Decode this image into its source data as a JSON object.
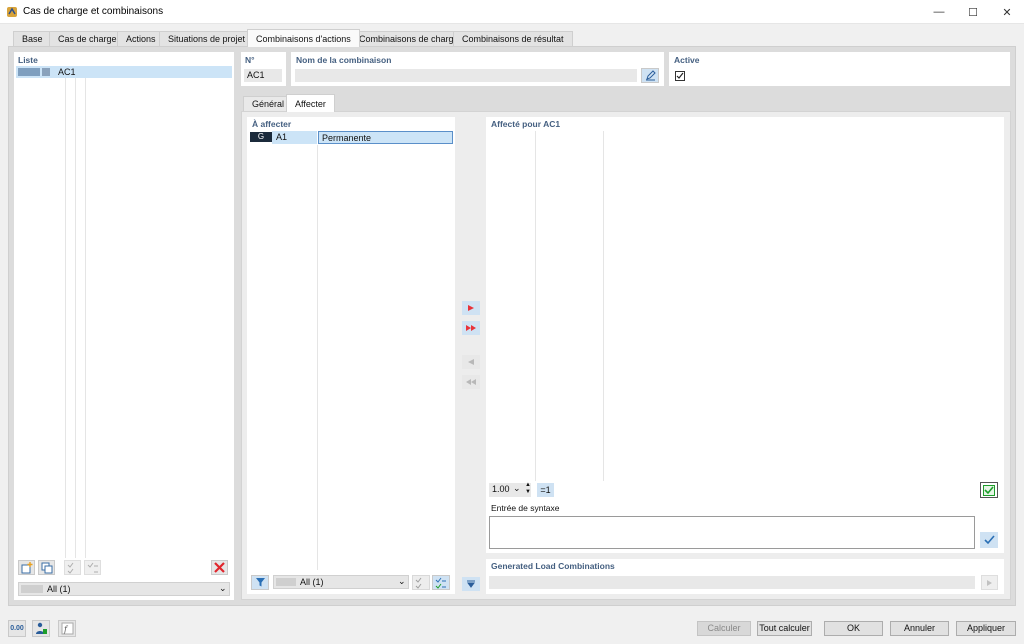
{
  "window": {
    "title": "Cas de charge et combinaisons",
    "minimize": "—",
    "maximize": "☐",
    "close": "✕"
  },
  "tabs": [
    {
      "label": "Base"
    },
    {
      "label": "Cas de charge"
    },
    {
      "label": "Actions"
    },
    {
      "label": "Situations de projet"
    },
    {
      "label": "Combinaisons d'actions"
    },
    {
      "label": "Combinaisons de charge"
    },
    {
      "label": "Combinaisons de résultat"
    }
  ],
  "list": {
    "title": "Liste",
    "item_label": "AC1",
    "filter_value": "All (1)",
    "item_colors": [
      "#7f9fbf",
      "#8aa2bc"
    ]
  },
  "header": {
    "no_label": "N°",
    "no_value": "AC1",
    "name_label": "Nom de la combinaison",
    "name_value": "",
    "active_label": "Active",
    "active_checked": true
  },
  "subtabs": [
    {
      "label": "Général"
    },
    {
      "label": "Affecter"
    }
  ],
  "to_assign": {
    "title": "À affecter",
    "rows": [
      {
        "tag": "G",
        "code": "A1",
        "name": "Permanente"
      }
    ],
    "filter_value": "All (1)"
  },
  "assigned": {
    "title": "Affecté pour AC1",
    "factor_value": "1.00",
    "eq1_label": "=1",
    "syntax_label": "Entrée de syntaxe",
    "syntax_value": ""
  },
  "generated": {
    "title": "Generated Load Combinations",
    "value": ""
  },
  "footer": {
    "calc": "Calculer",
    "calc_all": "Tout calculer",
    "ok": "OK",
    "cancel": "Annuler",
    "apply": "Appliquer",
    "units_icon_text": "0.00"
  },
  "colors": {
    "accent": "#445f80",
    "arrow_red": "#e8333a",
    "selected": "#cce4f7",
    "green": "#1e9e2b"
  }
}
